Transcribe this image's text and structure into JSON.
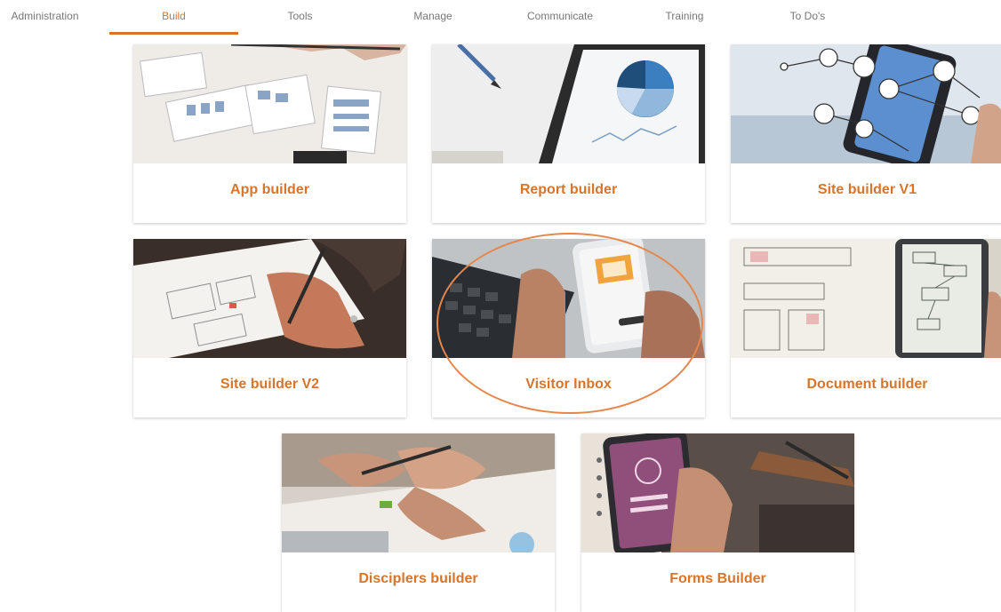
{
  "nav": {
    "items": [
      {
        "label": "Administration"
      },
      {
        "label": "Build"
      },
      {
        "label": "Tools"
      },
      {
        "label": "Manage"
      },
      {
        "label": "Communicate"
      },
      {
        "label": "Training"
      },
      {
        "label": "To Do's"
      }
    ],
    "active": "Build"
  },
  "colors": {
    "accent": "#d9742a",
    "nav_text": "#777777"
  },
  "cards": [
    {
      "label": "App builder",
      "image": "wireframe-sketches-photo"
    },
    {
      "label": "Report builder",
      "image": "tablet-pie-chart-photo"
    },
    {
      "label": "Site builder V1",
      "image": "phone-network-icons-photo"
    },
    {
      "label": "Site builder V2",
      "image": "hand-drawing-wireframe-photo"
    },
    {
      "label": "Visitor Inbox",
      "image": "phone-mail-laptop-photo"
    },
    {
      "label": "Document builder",
      "image": "document-flowchart-photo"
    },
    {
      "label": "Disciplers builder",
      "image": "meeting-hands-pen-photo"
    },
    {
      "label": "Forms Builder",
      "image": "phone-login-form-photo"
    }
  ],
  "highlighted_card": "Visitor Inbox"
}
